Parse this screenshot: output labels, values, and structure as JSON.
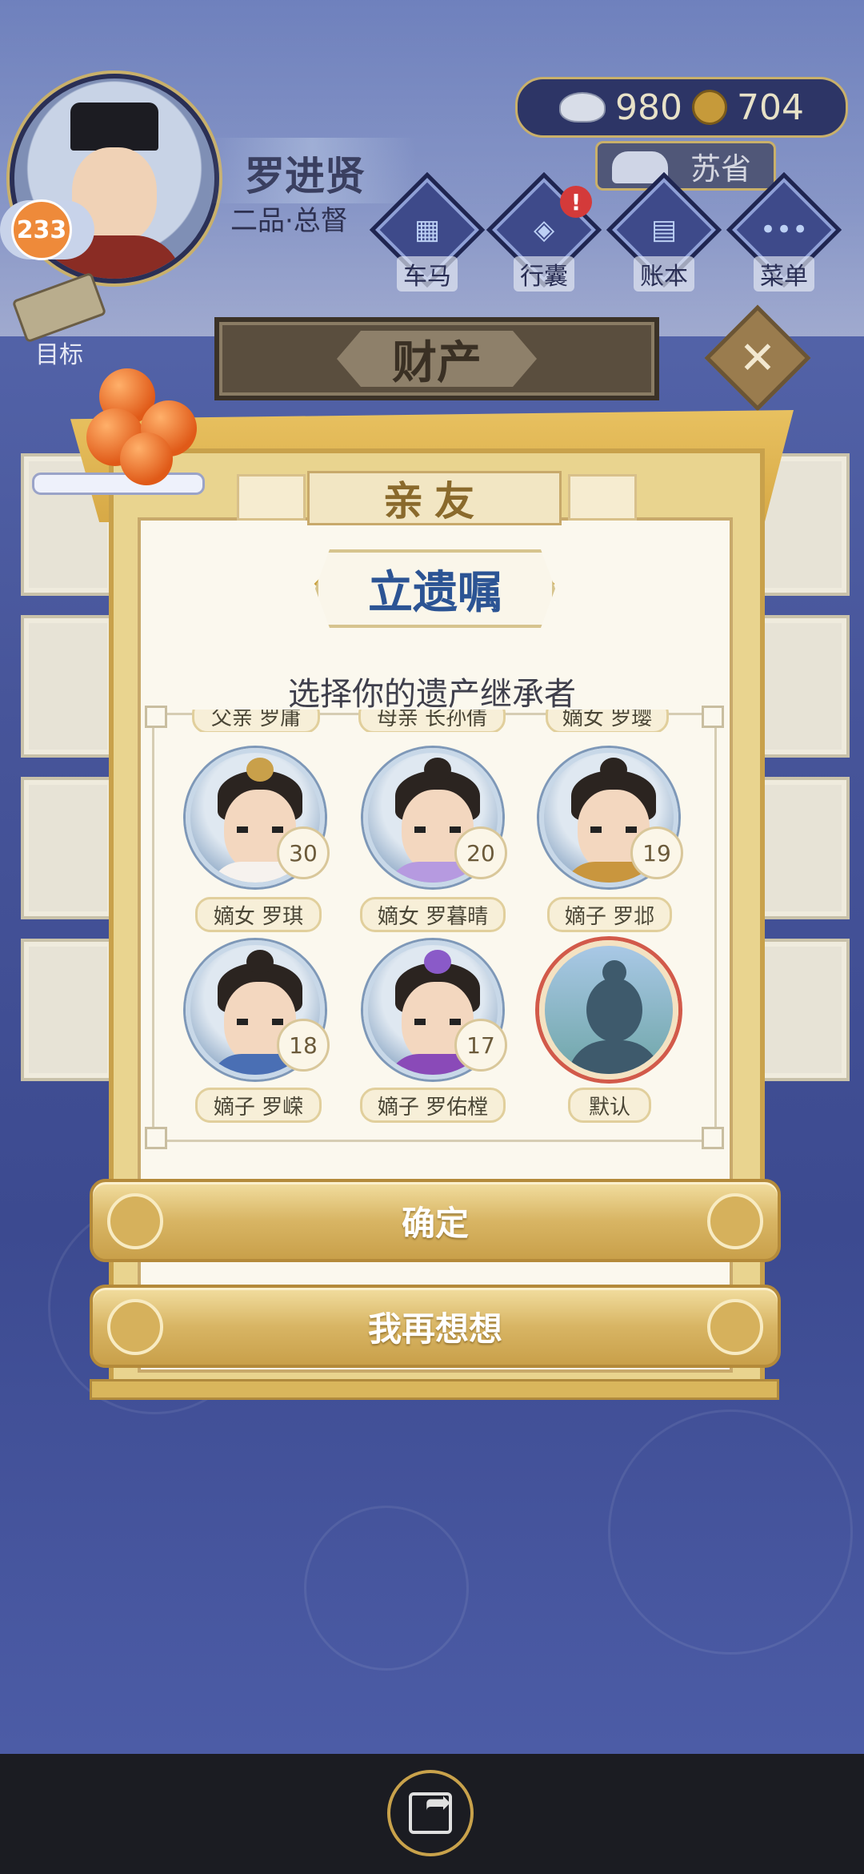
{
  "player": {
    "name": "罗进贤",
    "rank": "二品·总督",
    "level": "233"
  },
  "currency": {
    "silver": "980",
    "coins": "704"
  },
  "location": "苏省",
  "nav": [
    {
      "label": "车马",
      "icon": "carriage-icon"
    },
    {
      "label": "行囊",
      "icon": "bag-icon",
      "alert": "!"
    },
    {
      "label": "账本",
      "icon": "ledger-icon"
    },
    {
      "label": "菜单",
      "icon": "menu-icon",
      "glyph": "•••"
    }
  ],
  "target_label": "目标",
  "property_banner": "财产",
  "close_glyph": "✕",
  "tab_title": "亲友",
  "will_title": "立遗嘱",
  "subtitle": "选择你的遗产继承者",
  "top_row_labels": [
    "父亲 罗庸",
    "母亲 长孙倩",
    "嫡女 罗璎"
  ],
  "heirs": [
    {
      "label": "嫡女 罗琪",
      "age": "30"
    },
    {
      "label": "嫡女 罗暮晴",
      "age": "20"
    },
    {
      "label": "嫡子 罗邶",
      "age": "19"
    },
    {
      "label": "嫡子 罗嵘",
      "age": "18"
    },
    {
      "label": "嫡子 罗佑樘",
      "age": "17"
    },
    {
      "label": "默认"
    }
  ],
  "buttons": {
    "confirm": "确定",
    "reconsider": "我再想想"
  },
  "colors": {
    "accent_gold": "#d8b564",
    "title_blue": "#2c5494",
    "default_ring": "#d25a4a"
  }
}
